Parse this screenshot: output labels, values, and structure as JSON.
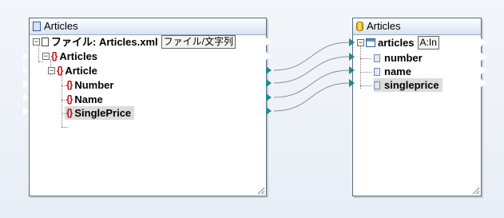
{
  "source": {
    "title": "Articles",
    "file_label": "ファイル: Articles.xml",
    "file_combo": "ファイル/文字列",
    "root": "Articles",
    "article": "Article",
    "fields": [
      "Number",
      "Name",
      "SinglePrice"
    ]
  },
  "target": {
    "title": "Articles",
    "table": "articles",
    "table_combo": "A:In",
    "columns": [
      "number",
      "name",
      "singleprice"
    ]
  },
  "colors": {
    "connected_port": "#1d8c8c",
    "link_line": "#8c8c8c",
    "element_icon": "#b1141c"
  }
}
